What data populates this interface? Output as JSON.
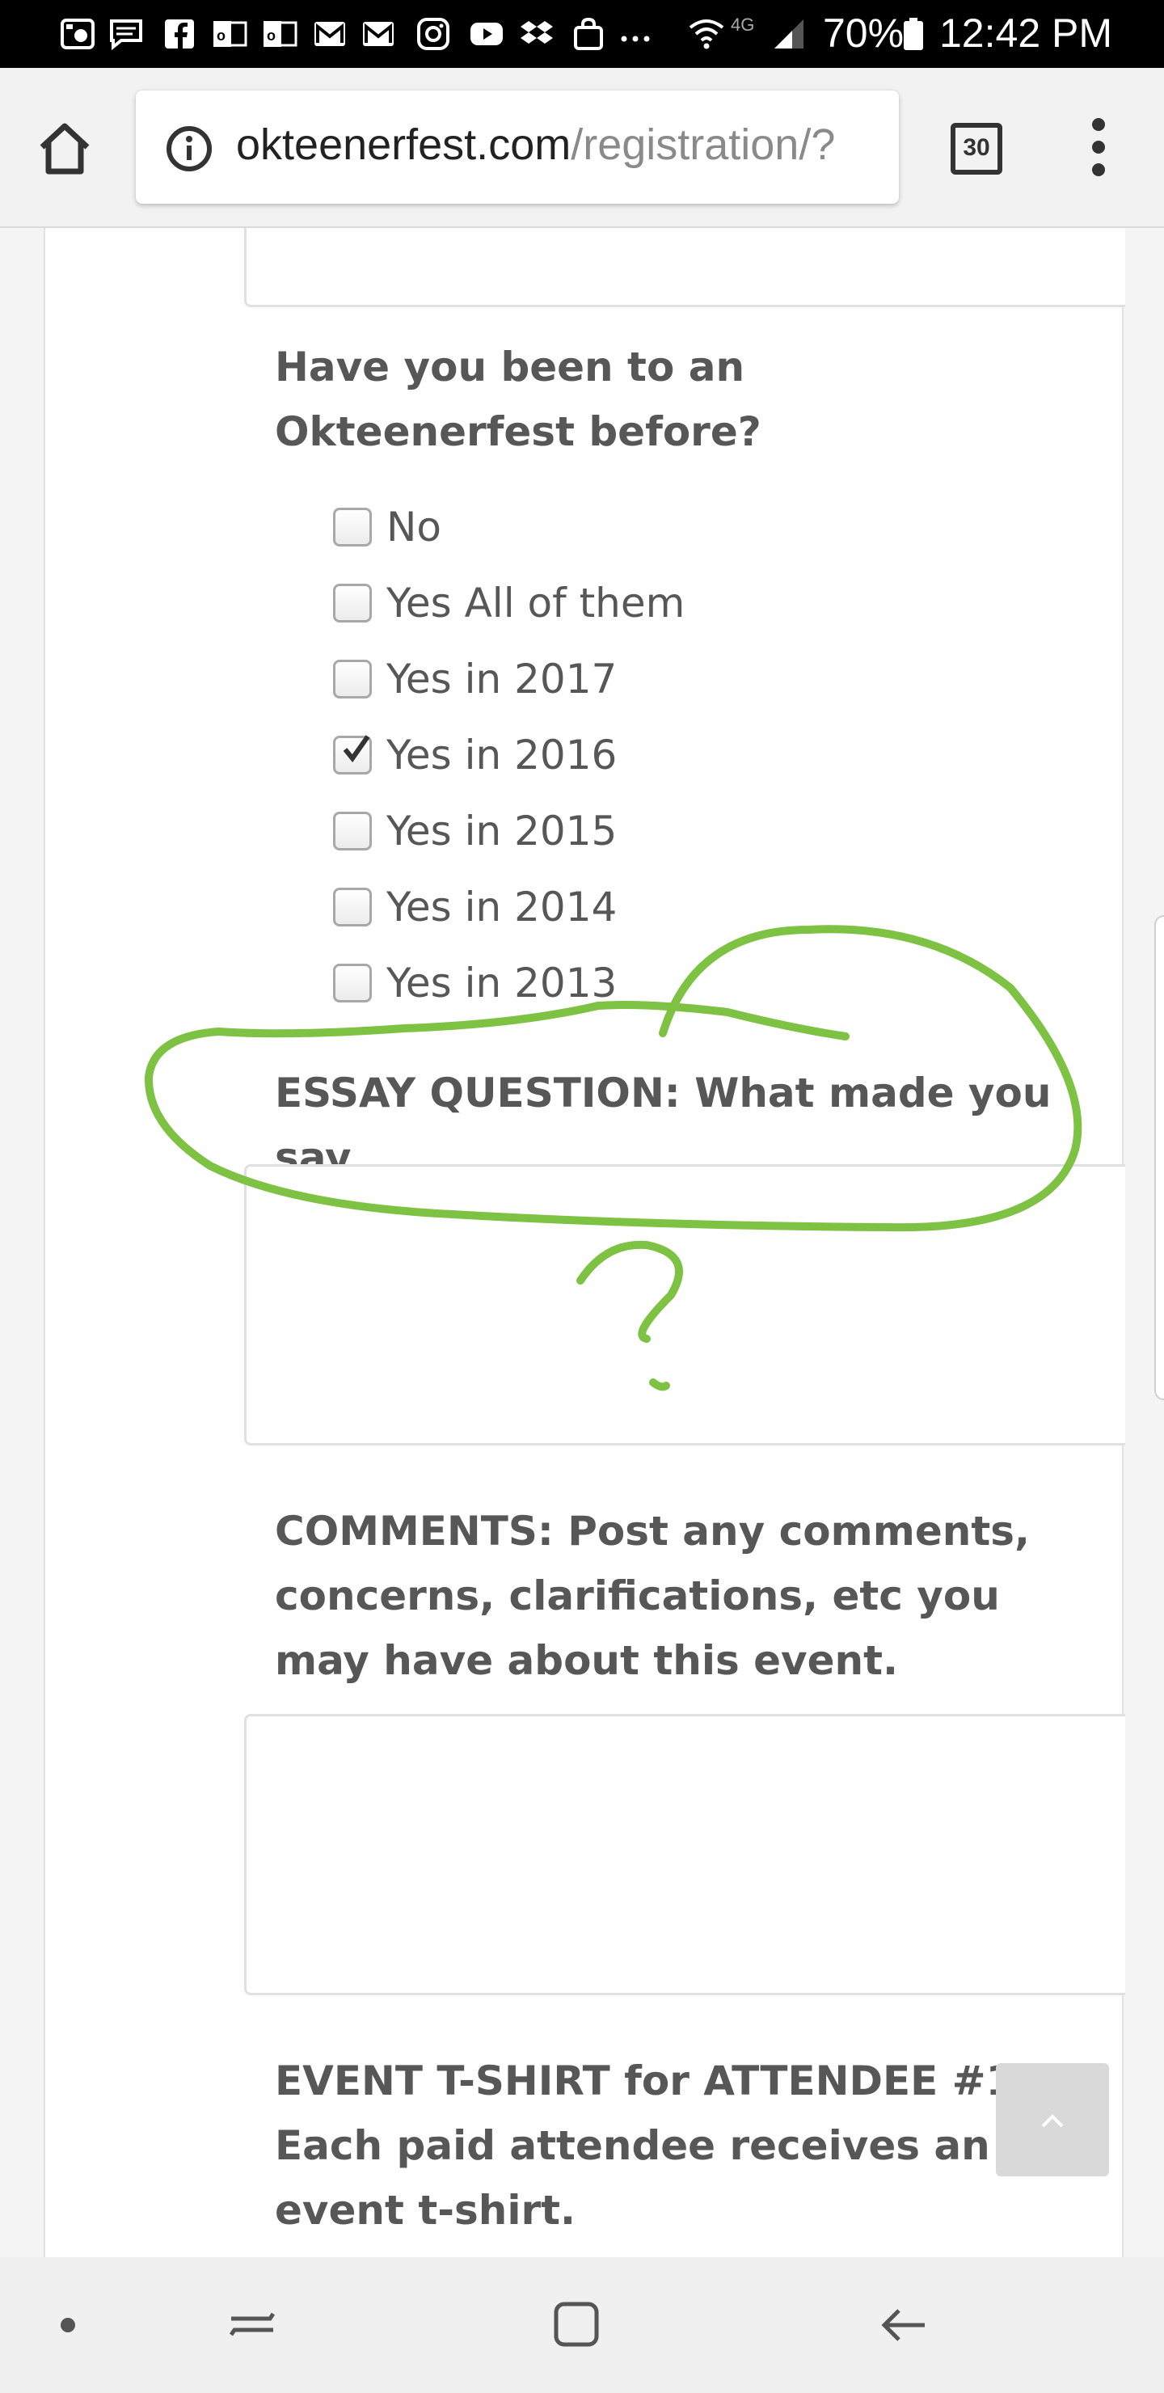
{
  "status_bar": {
    "icons": [
      "photo-app-icon",
      "messages-icon",
      "facebook-icon",
      "outlook-icon",
      "outlook-icon",
      "gmail-icon",
      "gmail-icon",
      "instagram-icon",
      "youtube-icon",
      "dropbox-icon",
      "shopping-icon",
      "more-notifications-icon",
      "wifi-icon",
      "lte-icon",
      "signal-icon",
      "battery-icon"
    ],
    "network": "4G",
    "battery": "70%",
    "time": "12:42 PM"
  },
  "browser": {
    "url_domain": "okteenerfest.com",
    "url_path": "/registration/?",
    "tab_count": "30"
  },
  "form": {
    "been_before_question": "Have you been to an Okteenerfest before?",
    "been_before_options": [
      {
        "label": "No",
        "checked": false
      },
      {
        "label": "Yes All of them",
        "checked": false
      },
      {
        "label": "Yes in 2017",
        "checked": false
      },
      {
        "label": "Yes in 2016",
        "checked": true
      },
      {
        "label": "Yes in 2015",
        "checked": false
      },
      {
        "label": "Yes in 2014",
        "checked": false
      },
      {
        "label": "Yes in 2013",
        "checked": false
      }
    ],
    "essay_question": "ESSAY QUESTION: What made you say",
    "comments_question": "COMMENTS: Post any comments, concerns, clarifications, etc you may have about this event.",
    "tshirt_question": "EVENT T-SHIRT for ATTENDEE #1- Each paid attendee receives an event t-shirt."
  },
  "annotation": {
    "color": "#7dc242",
    "mark": "?"
  },
  "colors": {
    "label": "#575757",
    "status_bar": "#000000",
    "toolbar": "#f2f2f2",
    "back_to_top": "#d9d9d9"
  }
}
